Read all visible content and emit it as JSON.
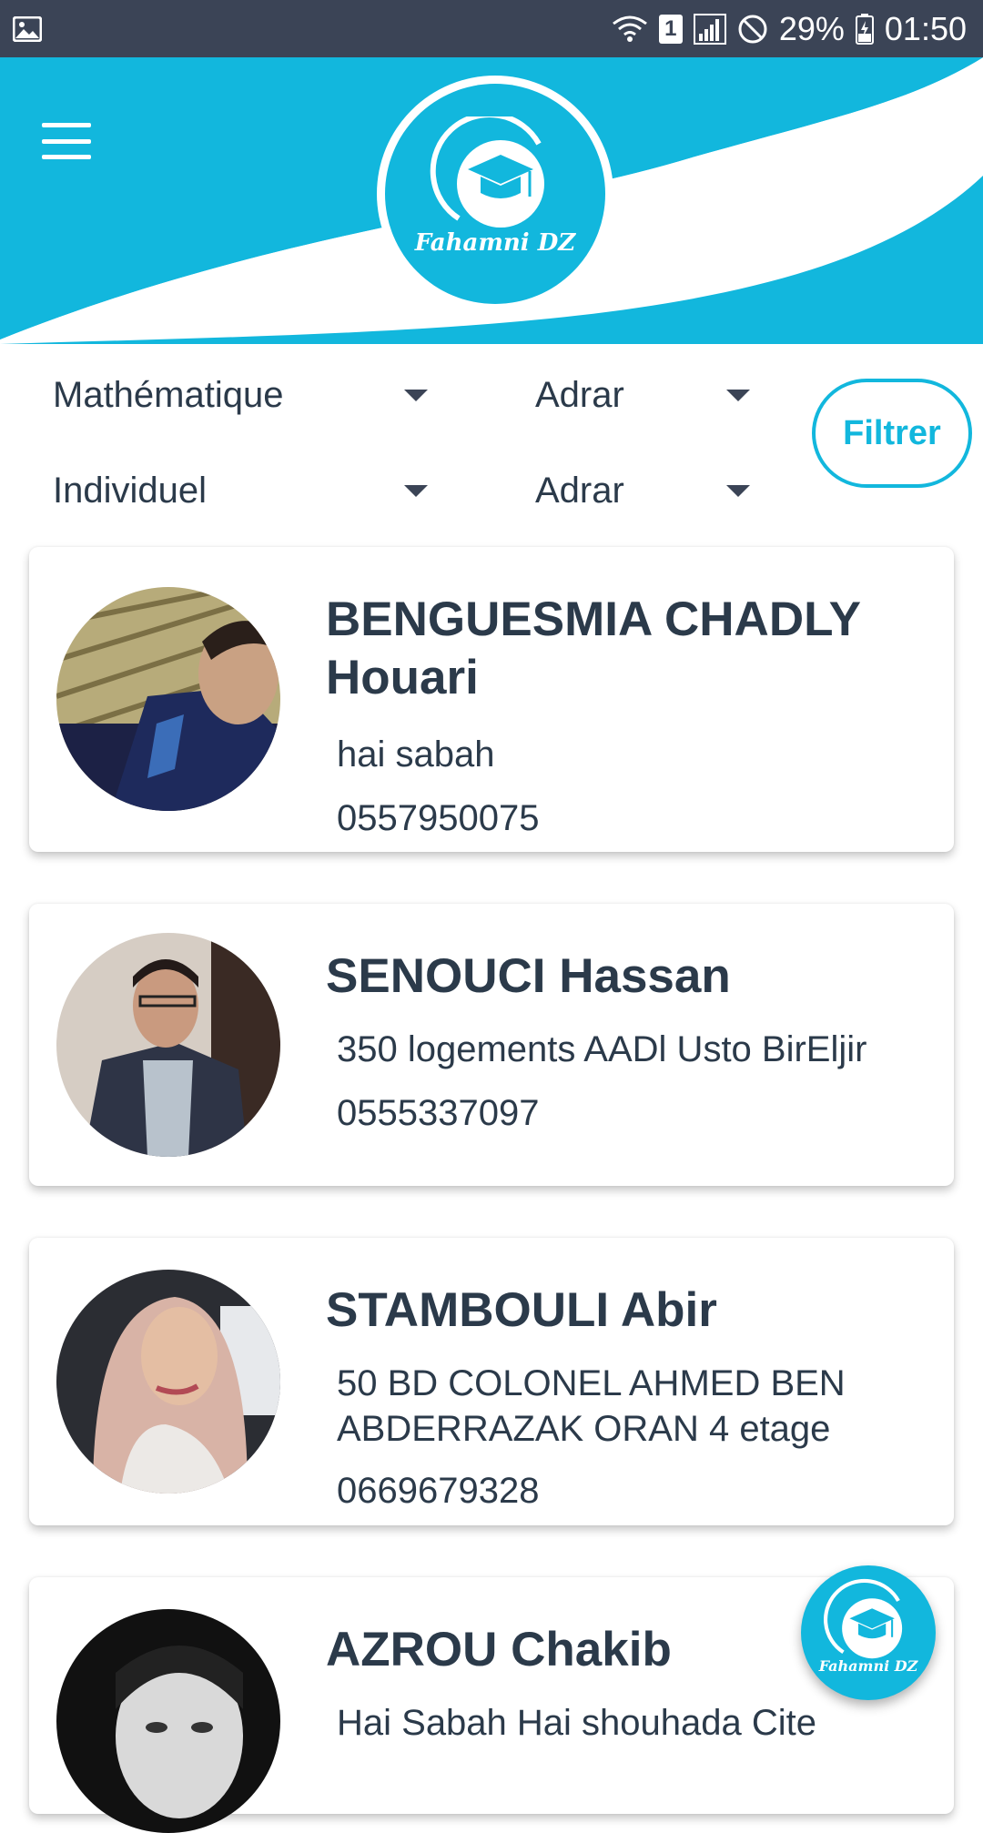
{
  "status_bar": {
    "battery": "29%",
    "time": "01:50",
    "sim": "1"
  },
  "header": {
    "logo_text": "Fahamni DZ",
    "accent": "#12b7dd"
  },
  "filters": {
    "subject": "Mathématique",
    "wilaya_top": "Adrar",
    "type": "Individuel",
    "wilaya_bottom": "Adrar",
    "button_label": "Filtrer"
  },
  "teachers": [
    {
      "name": "BENGUESMIA CHADLY Houari",
      "address": "hai sabah",
      "phone": "0557950075"
    },
    {
      "name": "SENOUCI Hassan",
      "address": "350 logements AADl Usto BirEljir",
      "phone": "0555337097"
    },
    {
      "name": "STAMBOULI Abir",
      "address": "50 BD COLONEL AHMED BEN ABDERRAZAK ORAN 4 etage",
      "phone": "0669679328"
    },
    {
      "name": "AZROU Chakib",
      "address": "Hai Sabah Hai shouhada Cite"
    }
  ],
  "fab": {
    "logo_text": "Fahamni DZ"
  },
  "icons": [
    "image-icon",
    "wifi-icon",
    "signal-icon",
    "do-not-disturb-icon",
    "battery-icon",
    "menu-icon",
    "graduation-cap-icon"
  ]
}
